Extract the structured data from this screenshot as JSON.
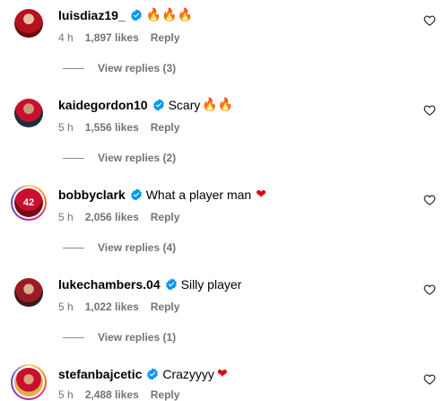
{
  "comments": [
    {
      "username": "luisdiaz19_",
      "text": "",
      "emoji": "🔥🔥🔥",
      "emoji_kind": "fire",
      "time": "4 h",
      "likes": "1,897 likes",
      "reply": "Reply",
      "view_replies": "View replies (3)",
      "avatar_style": "red",
      "story_ring": false
    },
    {
      "username": "kaidegordon10",
      "text": "Scary",
      "emoji": "🔥🔥",
      "emoji_kind": "fire",
      "time": "5 h",
      "likes": "1,556 likes",
      "reply": "Reply",
      "view_replies": "View replies (2)",
      "avatar_style": "dark",
      "story_ring": false
    },
    {
      "username": "bobbyclark",
      "text": "What a player man",
      "emoji": "❤",
      "emoji_kind": "heart",
      "time": "5 h",
      "likes": "2,056 likes",
      "reply": "Reply",
      "view_replies": "View replies (4)",
      "avatar_style": "num",
      "avatar_text": "42",
      "story_ring": true
    },
    {
      "username": "lukechambers.04",
      "text": "Silly player",
      "emoji": "",
      "emoji_kind": "",
      "time": "5 h",
      "likes": "1,022 likes",
      "reply": "Reply",
      "view_replies": "View replies (1)",
      "avatar_style": "maroon",
      "story_ring": false
    },
    {
      "username": "stefanbajcetic",
      "text": "Crazyyyy",
      "emoji": "❤",
      "emoji_kind": "heart",
      "time": "5 h",
      "likes": "2,488 likes",
      "reply": "Reply",
      "view_replies": "",
      "avatar_style": "gold",
      "story_ring": true
    }
  ],
  "icons": {
    "verified": "verified-badge-icon",
    "like": "heart-outline-icon"
  },
  "colors": {
    "verified_blue": "#0095f6",
    "secondary_text": "#737373",
    "heart_red": "#e3000f"
  }
}
